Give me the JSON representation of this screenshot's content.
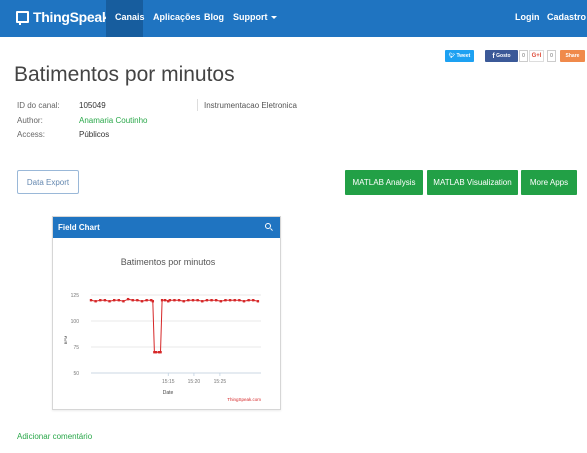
{
  "navbar": {
    "brand": "ThingSpeak",
    "items": [
      "Canais",
      "Aplicações",
      "Blog",
      "Support"
    ],
    "right": [
      "Login",
      "Cadastro"
    ]
  },
  "social": {
    "tweet": "Tweet",
    "facebook": "Gosto",
    "fb_count": "0",
    "gplus": "G+I",
    "gplus_count": "0",
    "share": "Share"
  },
  "page": {
    "title": "Batimentos por minutos"
  },
  "channel": {
    "id_label": "ID do canal:",
    "id_value": "105049",
    "author_label": "Author:",
    "author_value": "Anamaria Coutinho",
    "access_label": "Access:",
    "access_value": "Públicos",
    "description": "Instrumentacao Eletronica"
  },
  "buttons": {
    "data_export": "Data Export",
    "matlab_analysis": "MATLAB Analysis",
    "matlab_visualization": "MATLAB Visualization",
    "more_apps": "More Apps"
  },
  "panel": {
    "title": "Field Chart"
  },
  "chart_data": {
    "type": "line",
    "title": "Batimentos por minutos",
    "xlabel": "Date",
    "ylabel": "BPM",
    "credit": "ThingSpeak.com",
    "ylim": [
      50,
      125
    ],
    "yticks": [
      50,
      75,
      100,
      125
    ],
    "xlim": [
      15.0,
      15.55
    ],
    "xticks": [
      15.25,
      15.333,
      15.417
    ],
    "xtick_labels": [
      "15:15",
      "15:20",
      "15:25"
    ],
    "grid": true,
    "color": "#d62728",
    "x": [
      15.0,
      15.015,
      15.03,
      15.045,
      15.06,
      15.075,
      15.09,
      15.105,
      15.12,
      15.135,
      15.15,
      15.165,
      15.18,
      15.195,
      15.2,
      15.205,
      15.21,
      15.22,
      15.225,
      15.23,
      15.24,
      15.25,
      15.255,
      15.27,
      15.285,
      15.3,
      15.315,
      15.33,
      15.345,
      15.36,
      15.375,
      15.39,
      15.405,
      15.42,
      15.435,
      15.45,
      15.465,
      15.48,
      15.495,
      15.51,
      15.525,
      15.54
    ],
    "values": [
      120,
      119,
      120,
      120,
      119,
      120,
      120,
      119,
      121,
      120,
      120,
      119,
      120,
      120,
      119,
      70,
      70,
      70,
      70,
      120,
      120,
      119,
      120,
      120,
      120,
      119,
      120,
      120,
      120,
      119,
      120,
      120,
      120,
      119,
      120,
      120,
      120,
      120,
      119,
      120,
      120,
      119
    ]
  },
  "footer": {
    "add_comment": "Adicionar comentário"
  }
}
